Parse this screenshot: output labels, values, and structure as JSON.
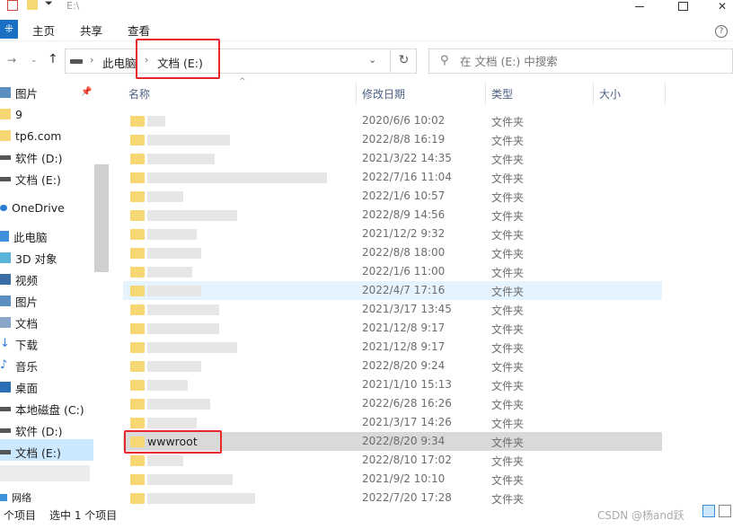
{
  "window": {
    "path": "E:\\"
  },
  "ribbon": {
    "file_tab": "⁜",
    "tabs": [
      "主页",
      "共享",
      "查看"
    ]
  },
  "address": {
    "crumbs": [
      "此电脑",
      "文档 (E:)"
    ]
  },
  "search": {
    "placeholder": "在 文档 (E:) 中搜索"
  },
  "nav": {
    "items": [
      {
        "label": "图片",
        "icon": "pictures-icon"
      },
      {
        "label": "9",
        "icon": "folder-icon"
      },
      {
        "label": "tp6.com",
        "icon": "folder-icon"
      },
      {
        "label": "软件 (D:)",
        "icon": "drive-icon"
      },
      {
        "label": "文档 (E:)",
        "icon": "drive-icon"
      },
      {
        "label": "OneDrive",
        "icon": "cloud-icon"
      },
      {
        "label": "此电脑",
        "icon": "computer-icon"
      },
      {
        "label": "3D 对象",
        "icon": "cube-icon"
      },
      {
        "label": "视频",
        "icon": "video-icon"
      },
      {
        "label": "图片",
        "icon": "pictures-icon"
      },
      {
        "label": "文档",
        "icon": "documents-icon"
      },
      {
        "label": "下载",
        "icon": "download-icon"
      },
      {
        "label": "音乐",
        "icon": "music-icon"
      },
      {
        "label": "桌面",
        "icon": "desktop-icon"
      },
      {
        "label": "本地磁盘 (C:)",
        "icon": "drive-icon"
      },
      {
        "label": "软件 (D:)",
        "icon": "drive-icon"
      },
      {
        "label": "文档 (E:)",
        "icon": "drive-icon"
      },
      {
        "label": "网络",
        "icon": "network-icon"
      }
    ]
  },
  "columns": {
    "name": "名称",
    "modified": "修改日期",
    "type": "类型",
    "size": "大小"
  },
  "files": [
    {
      "name": "",
      "date": "2020/6/6 10:02",
      "type": "文件夹"
    },
    {
      "name": "",
      "date": "2022/8/8 16:19",
      "type": "文件夹"
    },
    {
      "name": "",
      "date": "2021/3/22 14:35",
      "type": "文件夹"
    },
    {
      "name": "",
      "date": "2022/7/16 11:04",
      "type": "文件夹"
    },
    {
      "name": "",
      "date": "2022/1/6 10:57",
      "type": "文件夹"
    },
    {
      "name": "",
      "date": "2022/8/9 14:56",
      "type": "文件夹"
    },
    {
      "name": "",
      "date": "2021/12/2 9:32",
      "type": "文件夹"
    },
    {
      "name": "",
      "date": "2022/8/8 18:00",
      "type": "文件夹"
    },
    {
      "name": "",
      "date": "2022/1/6 11:00",
      "type": "文件夹"
    },
    {
      "name": "",
      "date": "2022/4/7 17:16",
      "type": "文件夹"
    },
    {
      "name": "",
      "date": "2021/3/17 13:45",
      "type": "文件夹"
    },
    {
      "name": "",
      "date": "2021/12/8 9:17",
      "type": "文件夹"
    },
    {
      "name": "",
      "date": "2021/12/8 9:17",
      "type": "文件夹"
    },
    {
      "name": "",
      "date": "2022/8/20 9:24",
      "type": "文件夹"
    },
    {
      "name": "",
      "date": "2021/1/10 15:13",
      "type": "文件夹"
    },
    {
      "name": "",
      "date": "2022/6/28 16:26",
      "type": "文件夹"
    },
    {
      "name": "",
      "date": "2021/3/17 14:26",
      "type": "文件夹"
    },
    {
      "name": "wwwroot",
      "date": "2022/8/20 9:34",
      "type": "文件夹"
    },
    {
      "name": "",
      "date": "2022/8/10 17:02",
      "type": "文件夹"
    },
    {
      "name": "",
      "date": "2021/9/2 10:10",
      "type": "文件夹"
    },
    {
      "name": "",
      "date": "2022/7/20 17:28",
      "type": "文件夹"
    }
  ],
  "status": {
    "count": "个项目",
    "selected": "选中 1 个项目"
  },
  "watermark": "CSDN @杨and跃",
  "colors": {
    "selected_row": "#d9d9d9",
    "hover_row": "#e5f3ff",
    "highlight_box": "#e8262b",
    "folder": "#f7d774",
    "file_tab": "#1a6fc4"
  }
}
